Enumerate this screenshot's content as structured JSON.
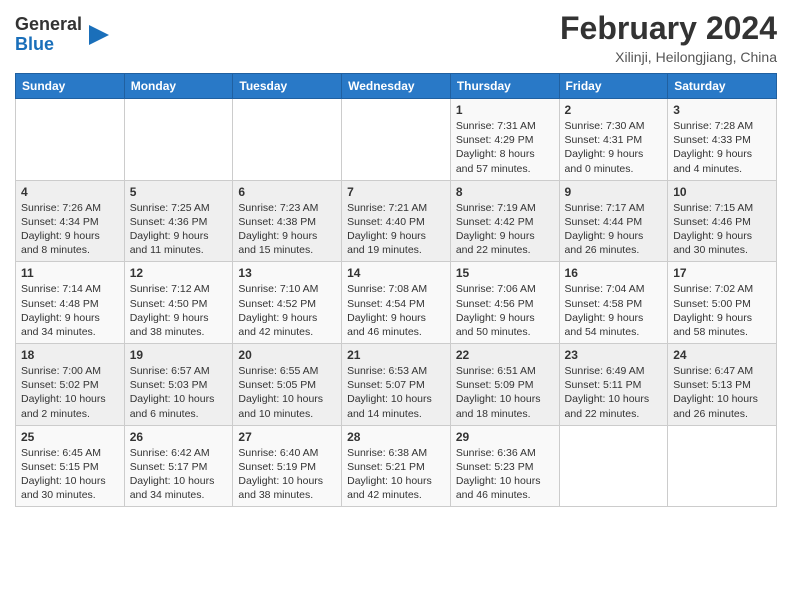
{
  "header": {
    "logo_line1": "General",
    "logo_line2": "Blue",
    "month_year": "February 2024",
    "location": "Xilinji, Heilongjiang, China"
  },
  "days_of_week": [
    "Sunday",
    "Monday",
    "Tuesday",
    "Wednesday",
    "Thursday",
    "Friday",
    "Saturday"
  ],
  "weeks": [
    [
      {
        "day": "",
        "info": ""
      },
      {
        "day": "",
        "info": ""
      },
      {
        "day": "",
        "info": ""
      },
      {
        "day": "",
        "info": ""
      },
      {
        "day": "1",
        "info": "Sunrise: 7:31 AM\nSunset: 4:29 PM\nDaylight: 8 hours\nand 57 minutes."
      },
      {
        "day": "2",
        "info": "Sunrise: 7:30 AM\nSunset: 4:31 PM\nDaylight: 9 hours\nand 0 minutes."
      },
      {
        "day": "3",
        "info": "Sunrise: 7:28 AM\nSunset: 4:33 PM\nDaylight: 9 hours\nand 4 minutes."
      }
    ],
    [
      {
        "day": "4",
        "info": "Sunrise: 7:26 AM\nSunset: 4:34 PM\nDaylight: 9 hours\nand 8 minutes."
      },
      {
        "day": "5",
        "info": "Sunrise: 7:25 AM\nSunset: 4:36 PM\nDaylight: 9 hours\nand 11 minutes."
      },
      {
        "day": "6",
        "info": "Sunrise: 7:23 AM\nSunset: 4:38 PM\nDaylight: 9 hours\nand 15 minutes."
      },
      {
        "day": "7",
        "info": "Sunrise: 7:21 AM\nSunset: 4:40 PM\nDaylight: 9 hours\nand 19 minutes."
      },
      {
        "day": "8",
        "info": "Sunrise: 7:19 AM\nSunset: 4:42 PM\nDaylight: 9 hours\nand 22 minutes."
      },
      {
        "day": "9",
        "info": "Sunrise: 7:17 AM\nSunset: 4:44 PM\nDaylight: 9 hours\nand 26 minutes."
      },
      {
        "day": "10",
        "info": "Sunrise: 7:15 AM\nSunset: 4:46 PM\nDaylight: 9 hours\nand 30 minutes."
      }
    ],
    [
      {
        "day": "11",
        "info": "Sunrise: 7:14 AM\nSunset: 4:48 PM\nDaylight: 9 hours\nand 34 minutes."
      },
      {
        "day": "12",
        "info": "Sunrise: 7:12 AM\nSunset: 4:50 PM\nDaylight: 9 hours\nand 38 minutes."
      },
      {
        "day": "13",
        "info": "Sunrise: 7:10 AM\nSunset: 4:52 PM\nDaylight: 9 hours\nand 42 minutes."
      },
      {
        "day": "14",
        "info": "Sunrise: 7:08 AM\nSunset: 4:54 PM\nDaylight: 9 hours\nand 46 minutes."
      },
      {
        "day": "15",
        "info": "Sunrise: 7:06 AM\nSunset: 4:56 PM\nDaylight: 9 hours\nand 50 minutes."
      },
      {
        "day": "16",
        "info": "Sunrise: 7:04 AM\nSunset: 4:58 PM\nDaylight: 9 hours\nand 54 minutes."
      },
      {
        "day": "17",
        "info": "Sunrise: 7:02 AM\nSunset: 5:00 PM\nDaylight: 9 hours\nand 58 minutes."
      }
    ],
    [
      {
        "day": "18",
        "info": "Sunrise: 7:00 AM\nSunset: 5:02 PM\nDaylight: 10 hours\nand 2 minutes."
      },
      {
        "day": "19",
        "info": "Sunrise: 6:57 AM\nSunset: 5:03 PM\nDaylight: 10 hours\nand 6 minutes."
      },
      {
        "day": "20",
        "info": "Sunrise: 6:55 AM\nSunset: 5:05 PM\nDaylight: 10 hours\nand 10 minutes."
      },
      {
        "day": "21",
        "info": "Sunrise: 6:53 AM\nSunset: 5:07 PM\nDaylight: 10 hours\nand 14 minutes."
      },
      {
        "day": "22",
        "info": "Sunrise: 6:51 AM\nSunset: 5:09 PM\nDaylight: 10 hours\nand 18 minutes."
      },
      {
        "day": "23",
        "info": "Sunrise: 6:49 AM\nSunset: 5:11 PM\nDaylight: 10 hours\nand 22 minutes."
      },
      {
        "day": "24",
        "info": "Sunrise: 6:47 AM\nSunset: 5:13 PM\nDaylight: 10 hours\nand 26 minutes."
      }
    ],
    [
      {
        "day": "25",
        "info": "Sunrise: 6:45 AM\nSunset: 5:15 PM\nDaylight: 10 hours\nand 30 minutes."
      },
      {
        "day": "26",
        "info": "Sunrise: 6:42 AM\nSunset: 5:17 PM\nDaylight: 10 hours\nand 34 minutes."
      },
      {
        "day": "27",
        "info": "Sunrise: 6:40 AM\nSunset: 5:19 PM\nDaylight: 10 hours\nand 38 minutes."
      },
      {
        "day": "28",
        "info": "Sunrise: 6:38 AM\nSunset: 5:21 PM\nDaylight: 10 hours\nand 42 minutes."
      },
      {
        "day": "29",
        "info": "Sunrise: 6:36 AM\nSunset: 5:23 PM\nDaylight: 10 hours\nand 46 minutes."
      },
      {
        "day": "",
        "info": ""
      },
      {
        "day": "",
        "info": ""
      }
    ]
  ]
}
